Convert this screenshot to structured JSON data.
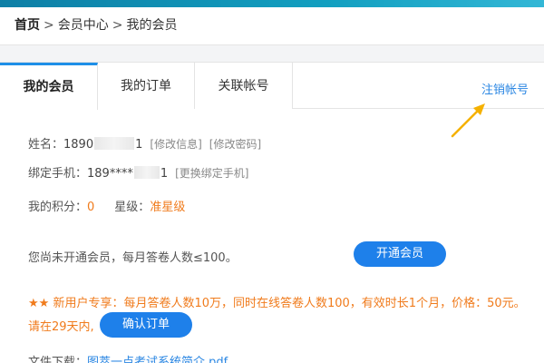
{
  "breadcrumb": {
    "home": "首页",
    "sep1": ">",
    "member_center": "会员中心",
    "sep2": ">",
    "current": "我的会员"
  },
  "tabs": [
    {
      "label": "我的会员",
      "active": true
    },
    {
      "label": "我的订单",
      "active": false
    },
    {
      "label": "关联帐号",
      "active": false
    }
  ],
  "cancel_account": "注销帐号",
  "profile": {
    "name_label": "姓名：",
    "name_prefix": "1890",
    "name_suffix": "1",
    "edit_info": "[修改信息]",
    "edit_password": "[修改密码]",
    "phone_label": "绑定手机：",
    "phone_prefix": "189****",
    "phone_suffix": "1",
    "change_phone": "[更换绑定手机]",
    "points_label": "我的积分：",
    "points_value": "0",
    "level_label": "星级：",
    "level_value": "准星级"
  },
  "membership": {
    "notice": "您尚未开通会员，每月答卷人数≤100。",
    "activate_button": "开通会员"
  },
  "offer": {
    "line1": "★★ 新用户专享：每月答卷人数10万，同时在线答卷人数100，有效时长1个月，价格：50元。",
    "line2": "请在29天内,",
    "confirm_button": "确认订单"
  },
  "file": {
    "label": "文件下载：",
    "link": "图萃一点考试系统简介.pdf"
  },
  "colors": {
    "accent_blue": "#1e80ea",
    "link_blue": "#2b87e3",
    "orange": "#f07b1c",
    "arrow": "#f5b100"
  }
}
